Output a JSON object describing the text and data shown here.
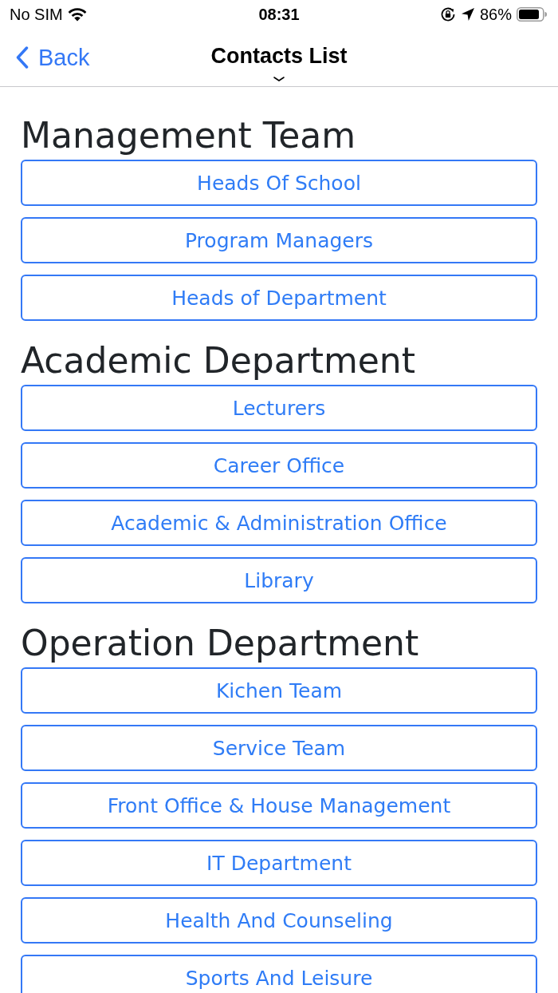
{
  "status_bar": {
    "carrier": "No SIM",
    "time": "08:31",
    "battery": "86%"
  },
  "nav_bar": {
    "back": "Back",
    "title": "Contacts List"
  },
  "sections": [
    {
      "title": "Management Team",
      "buttons": [
        "Heads Of School",
        "Program Managers",
        "Heads of Department"
      ]
    },
    {
      "title": "Academic Department",
      "buttons": [
        "Lecturers",
        "Career Office",
        "Academic & Administration Office",
        "Library"
      ]
    },
    {
      "title": "Operation Department",
      "buttons": [
        "Kichen Team",
        "Service Team",
        "Front Office & House Management",
        "IT Department",
        "Health And Counseling",
        "Sports And Leisure"
      ]
    }
  ]
}
